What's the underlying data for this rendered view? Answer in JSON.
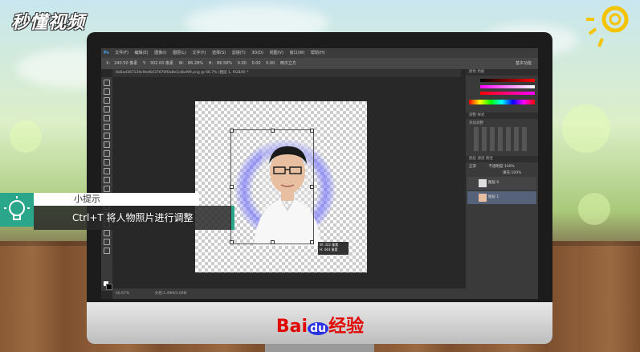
{
  "brand": {
    "logo": "秒懂视频",
    "footer_b": "Bai",
    "footer_du": "du",
    "footer_jy": "经验"
  },
  "ps": {
    "app": "Ps",
    "menu": [
      "文件(F)",
      "编辑(E)",
      "图像(I)",
      "图层(L)",
      "文字(Y)",
      "选择(S)",
      "滤镜(T)",
      "3D(D)",
      "视图(V)",
      "窗口(W)",
      "帮助(H)"
    ],
    "options": {
      "x": "240.50 像素",
      "y": "302.00 像素",
      "w": "86.28%",
      "h": "86.58%",
      "angle": "0.00",
      "hskew": "0.00",
      "vskew": "0.00",
      "interp": "两次立方",
      "workspace": "基本功能"
    },
    "doc_tab": "8a6ad367139c9ed6437670f0a8e1cdbd99.png @ 66.7% (图层 1, RGB/8) *",
    "status": {
      "zoom": "66.67%",
      "doc": "文档:1.49M/3.69M"
    },
    "transform_readout": {
      "w": "W: 322 像素",
      "h": "H: 444 像素"
    },
    "panels": {
      "color_tab": "颜色",
      "swatches_tab": "色板",
      "adjust_tab": "调整",
      "styles_tab": "样式",
      "adjust_title": "添加调整",
      "layers_tab": "图层",
      "channels_tab": "通道",
      "paths_tab": "路径",
      "blend": "正常",
      "opacity_label": "不透明度:",
      "opacity": "100%",
      "fill_label": "填充:",
      "fill": "100%",
      "layers": [
        "图层 0",
        "图层 1"
      ]
    }
  },
  "tip": {
    "title": "小提示",
    "body": "Ctrl+T 将人物照片进行调整"
  }
}
